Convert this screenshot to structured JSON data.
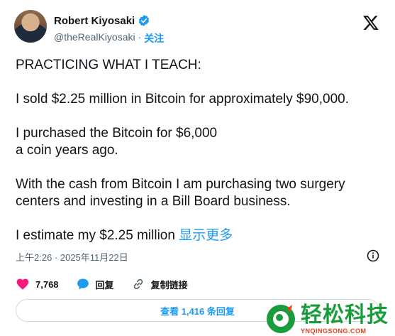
{
  "author": {
    "name": "Robert Kiyosaki",
    "handle": "@theRealKiyosaki",
    "separator": "·",
    "follow_label": "关注"
  },
  "tweet": {
    "paragraphs": [
      "PRACTICING WHAT I TEACH:",
      "I sold $2.25 million in Bitcoin for approximately $90,000.",
      "I purchased the Bitcoin for $6,000\na coin years ago.",
      "With the cash from Bitcoin I am purchasing two surgery centers and investing in a Bill Board business."
    ],
    "truncated_text": "I estimate my $2.25 million",
    "show_more_label": "显示更多"
  },
  "meta": {
    "timestamp": "上午2:26 · 2025年11月22日"
  },
  "actions": {
    "likes_count": "7,768",
    "reply_label": "回复",
    "copy_link_label": "复制链接"
  },
  "replies_button": {
    "label": "查看 1,416 条回复"
  },
  "watermark": {
    "text_cn": "轻松科技",
    "text_en": "YNQINGSONG.COM"
  },
  "colors": {
    "accent": "#1d9bf0",
    "like": "#f91880",
    "text": "#0f1419",
    "muted": "#536471",
    "watermark_green": "#1a9c3c"
  },
  "icons": [
    "verified-badge-icon",
    "x-logo-icon",
    "info-icon",
    "heart-icon",
    "reply-bubble-icon",
    "link-icon"
  ]
}
